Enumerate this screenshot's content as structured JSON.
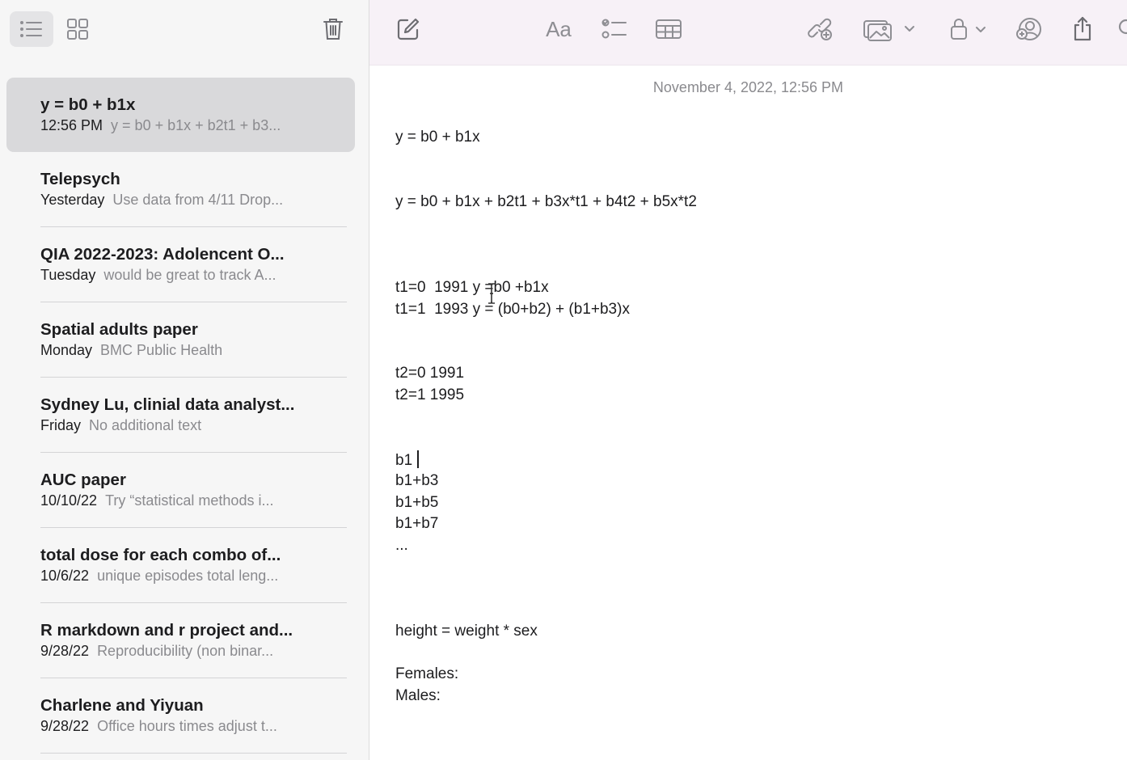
{
  "sidebar": {
    "toolbar": {
      "list_view_icon": "list-view-icon",
      "gallery_view_icon": "gallery-view-icon",
      "delete_icon": "trash-icon"
    },
    "notes": [
      {
        "title": "y = b0 + b1x",
        "date": "12:56 PM",
        "snippet": "y = b0 + b1x + b2t1 + b3...",
        "selected": true
      },
      {
        "title": "Telepsych",
        "date": "Yesterday",
        "snippet": "Use data from 4/11 Drop..."
      },
      {
        "title": "QIA 2022-2023: Adolencent O...",
        "date": "Tuesday",
        "snippet": "would be great to track A..."
      },
      {
        "title": "Spatial adults paper",
        "date": "Monday",
        "snippet": "BMC Public Health"
      },
      {
        "title": "Sydney Lu, clinial data analyst...",
        "date": "Friday",
        "snippet": "No additional text"
      },
      {
        "title": "AUC paper",
        "date": "10/10/22",
        "snippet": "Try “statistical methods i..."
      },
      {
        "title": "total dose for each combo of...",
        "date": "10/6/22",
        "snippet": "unique episodes total leng..."
      },
      {
        "title": "R markdown and r project and...",
        "date": "9/28/22",
        "snippet": "Reproducibility (non binar..."
      },
      {
        "title": "Charlene and Yiyuan",
        "date": "9/28/22",
        "snippet": "Office hours times adjust t..."
      }
    ]
  },
  "editor": {
    "toolbar": {
      "format_label": "Aa"
    },
    "date": "November 4, 2022, 12:56 PM",
    "lines": {
      "l1": "y = b0 + b1x",
      "l2": "y = b0 + b1x + b2t1 + b3x*t1 + b4t2 + b5x*t2",
      "l3": "t1=0  1991 y =b0 +b1x",
      "l4": "t1=1  1993 y = (b0+b2) + (b1+b3)x",
      "l5": "t2=0 1991",
      "l6": "t2=1 1995",
      "l7": "b1",
      "l8": "b1+b3",
      "l9": "b1+b5",
      "l10": "b1+b7",
      "l11": "...",
      "l12": "height = weight * sex",
      "l13": "Females:",
      "l14": "Males:"
    }
  },
  "colors": {
    "toolbar_bg": "#f7f1f7",
    "sidebar_bg": "#f6f6f6",
    "selected_bg": "#d9d9db",
    "secondary_text": "#8a8a8e"
  }
}
